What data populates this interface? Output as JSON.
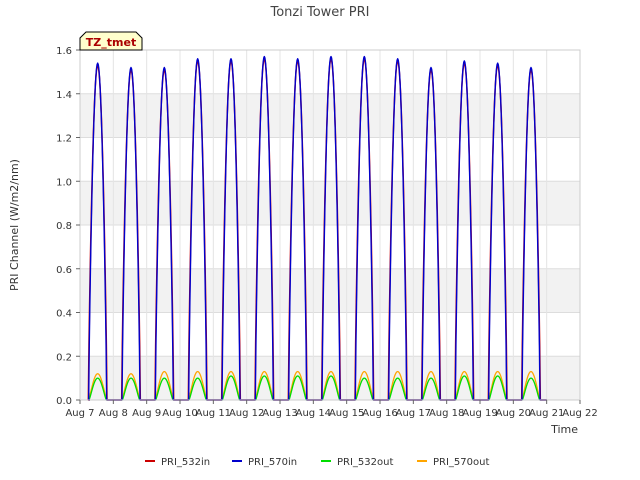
{
  "chart_data": {
    "type": "line",
    "title": "Tonzi Tower PRI",
    "xlabel": "Time",
    "ylabel": "PRI Channel (W/m2/nm)",
    "xlim": [
      7,
      22
    ],
    "ylim": [
      0.0,
      1.6
    ],
    "x_ticks": [
      7,
      8,
      9,
      10,
      11,
      12,
      13,
      14,
      15,
      16,
      17,
      18,
      19,
      20,
      21,
      22
    ],
    "x_tick_labels": [
      "Aug 7",
      "Aug 8",
      "Aug 9",
      "Aug 10",
      "Aug 11",
      "Aug 12",
      "Aug 13",
      "Aug 14",
      "Aug 15",
      "Aug 16",
      "Aug 17",
      "Aug 18",
      "Aug 19",
      "Aug 20",
      "Aug 21",
      "Aug 22"
    ],
    "y_ticks": [
      0.0,
      0.2,
      0.4,
      0.6,
      0.8,
      1.0,
      1.2,
      1.4,
      1.6
    ],
    "y_tick_labels": [
      "0.0",
      "0.2",
      "0.4",
      "0.6",
      "0.8",
      "1.0",
      "1.2",
      "1.4",
      "1.6"
    ],
    "grid": true,
    "banded_background": true,
    "legend_position": "bottom",
    "annotation_box": "TZ_tmet",
    "days": [
      7,
      8,
      9,
      10,
      11,
      12,
      13,
      14,
      15,
      16,
      17,
      18,
      19,
      20
    ],
    "daily_peaks": {
      "PRI_570in": [
        1.54,
        1.52,
        1.52,
        1.56,
        1.56,
        1.57,
        1.56,
        1.57,
        1.57,
        1.56,
        1.52,
        1.55,
        1.54,
        1.52
      ],
      "PRI_532in": [
        1.53,
        1.51,
        1.51,
        1.55,
        1.55,
        1.56,
        1.55,
        1.56,
        1.56,
        1.55,
        1.51,
        1.54,
        1.53,
        1.51
      ],
      "PRI_532out": [
        0.1,
        0.1,
        0.1,
        0.1,
        0.11,
        0.11,
        0.11,
        0.11,
        0.1,
        0.1,
        0.1,
        0.11,
        0.11,
        0.1
      ],
      "PRI_570out": [
        0.12,
        0.12,
        0.13,
        0.13,
        0.13,
        0.13,
        0.13,
        0.13,
        0.13,
        0.13,
        0.13,
        0.13,
        0.13,
        0.13
      ]
    },
    "series": [
      {
        "name": "PRI_532in",
        "color": "#cc0000"
      },
      {
        "name": "PRI_570in",
        "color": "#0000cc"
      },
      {
        "name": "PRI_532out",
        "color": "#00dd00"
      },
      {
        "name": "PRI_570out",
        "color": "#ffa500"
      }
    ]
  }
}
